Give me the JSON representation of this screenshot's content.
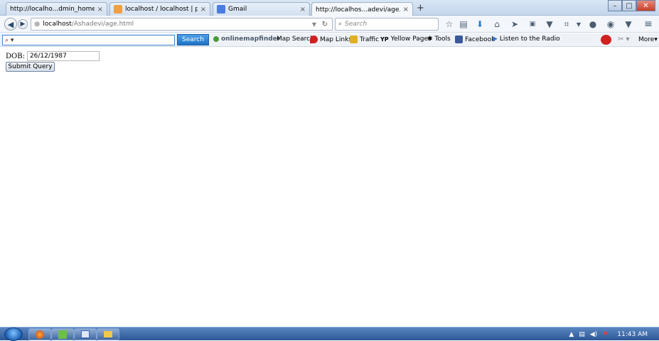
{
  "tabs": [
    {
      "title": "http://localho...dmin_home.php",
      "icon": "blank-page-icon",
      "color": "#ffffff",
      "active": false
    },
    {
      "title": "localhost / localhost | php...",
      "icon": "phpmyadmin-icon",
      "color": "#f0a040",
      "active": false
    },
    {
      "title": "Gmail",
      "icon": "google-icon",
      "color": "#4a7de0",
      "active": false
    },
    {
      "title": "http://localhos...adevi/age.html",
      "icon": "blank-page-icon",
      "color": "#ffffff",
      "active": true
    }
  ],
  "close_glyph": "×",
  "new_tab_glyph": "+",
  "url": {
    "host": "localhost",
    "path": "/Ashadevi/age.html"
  },
  "search_placeholder": "Search",
  "bookmarks": {
    "search_button": "Search",
    "search_icon": "magnifier-icon",
    "items": [
      {
        "label": "Map Search",
        "icon": "onlinemapfinder-icon",
        "color": "#4a9a3a"
      },
      {
        "label": "Map Links",
        "icon": "map-pin-icon",
        "color": "#d02020"
      },
      {
        "label": "Traffic",
        "icon": "traffic-light-icon",
        "color": "#e0b020"
      },
      {
        "label": "Yellow Pages",
        "icon": "yp-icon",
        "color": "#222222"
      },
      {
        "label": "Tools",
        "icon": "gear-icon",
        "color": "#222222"
      },
      {
        "label": "Facebook",
        "icon": "facebook-icon",
        "color": "#3b5998"
      },
      {
        "label": "Listen to the Radio",
        "icon": "play-icon",
        "color": "#3a70c8"
      }
    ],
    "brand": "onlinemapfinder",
    "more_label": "More"
  },
  "form": {
    "dob_label": "DOB:",
    "dob_value": "26/12/1987",
    "submit_label": "Submit Query"
  },
  "taskbar": {
    "clock": "11:43 AM"
  }
}
